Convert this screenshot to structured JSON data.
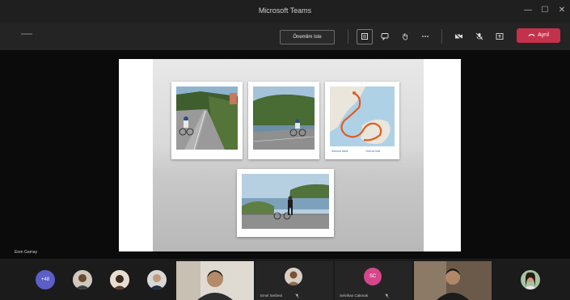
{
  "window": {
    "title": "Microsoft Teams",
    "minimize": "—",
    "maximize": "☐",
    "close": "✕"
  },
  "toolbar": {
    "meeting_notes_label": "Önemlim Iste",
    "leave_label": "Ayrıl",
    "icons": [
      "participants-icon",
      "chat-icon",
      "raise-hand-icon",
      "more-icon",
      "camera-off-icon",
      "mic-icon",
      "share-icon"
    ]
  },
  "stage": {
    "presenter_name": "Eren Gamay",
    "map_links": [
      "Sonuna dahil",
      "Yola ac kita"
    ]
  },
  "gallery": {
    "overflow_count": "+48",
    "participants": [
      {
        "name": "Emel Serbest"
      },
      {
        "name": "Selvihan Cakmak"
      },
      {
        "initials": "SC"
      }
    ]
  },
  "colors": {
    "leave": "#c4314b",
    "overflow_avatar": "#5b5fc7",
    "initials_avatar": "#d6478a"
  }
}
